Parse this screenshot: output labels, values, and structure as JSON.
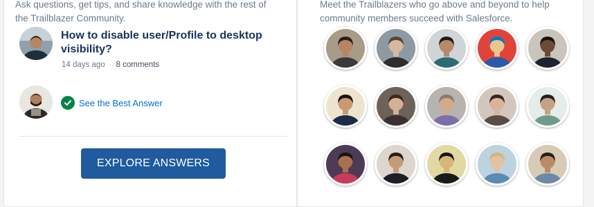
{
  "questions_card": {
    "description": "Ask questions, get tips, and share knowledge with the rest of\nthe Trailblazer Community.",
    "question": {
      "title": "How to disable user/Profile to desktop visibility?",
      "age": "14 days ago",
      "separator": "·",
      "comments": "8 comments"
    },
    "best_answer_label": "See the Best Answer",
    "explore_button": "EXPLORE ANSWERS"
  },
  "trailblazers_card": {
    "description": "Meet the Trailblazers who go above and beyond to help\ncommunity members succeed with Salesforce.",
    "avatars": [
      {
        "bg": "#a89b88",
        "skin": "#b58663",
        "shirt": "#3a3a3a",
        "hair": "#2a1e16"
      },
      {
        "bg": "#8e9aa3",
        "skin": "#d7b8a0",
        "shirt": "#2e2e2e",
        "hair": "#5a4535"
      },
      {
        "bg": "#cfd4d8",
        "skin": "#b48a6a",
        "shirt": "#2c6b74",
        "hair": "#1f1a17"
      },
      {
        "bg": "#e0433a",
        "skin": "#e8c68e",
        "shirt": "#2b5aa8",
        "hair": "#0b78c9"
      },
      {
        "bg": "#c9c4bc",
        "skin": "#6d4a33",
        "shirt": "#1f2230",
        "hair": "#1a1410"
      },
      {
        "bg": "#ede4cf",
        "skin": "#c99a72",
        "shirt": "#1d2b4a",
        "hair": "#1a1410"
      },
      {
        "bg": "#6c625a",
        "skin": "#d4b095",
        "shirt": "#3b3030",
        "hair": "#3a2a20"
      },
      {
        "bg": "#b7b3b0",
        "skin": "#d2aa8a",
        "shirt": "#7c6ea8",
        "hair": "#8a7a70"
      },
      {
        "bg": "#d3c6bd",
        "skin": "#d9b39a",
        "shirt": "#5b4b45",
        "hair": "#3a2620"
      },
      {
        "bg": "#e6ece8",
        "skin": "#c7a184",
        "shirt": "#6f9c8a",
        "hair": "#2a1e18"
      },
      {
        "bg": "#4d3b55",
        "skin": "#a8704c",
        "shirt": "#c93b5a",
        "hair": "#1c1412"
      },
      {
        "bg": "#ddd6cf",
        "skin": "#c59a7a",
        "shirt": "#1e1e24",
        "hair": "#2a1c14"
      },
      {
        "bg": "#e2d9a2",
        "skin": "#d9b57a",
        "shirt": "#1a1a1a",
        "hair": "#151515"
      },
      {
        "bg": "#bcd3e0",
        "skin": "#e2c2a4",
        "shirt": "#5d89b5",
        "hair": "#d8b37a"
      },
      {
        "bg": "#d7cbb6",
        "skin": "#b98b66",
        "shirt": "#6f87a8",
        "hair": "#2a1e16"
      }
    ]
  },
  "colors": {
    "navy_text": "#16325c",
    "link_blue": "#0070d2",
    "button_blue": "#1f5b9e",
    "success_green": "#04844b",
    "muted_text": "#6b7a8c"
  }
}
